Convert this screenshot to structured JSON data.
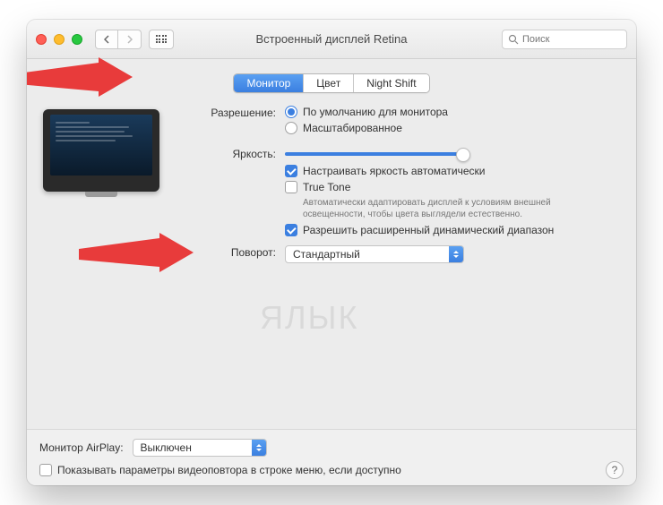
{
  "window": {
    "title": "Встроенный дисплей Retina"
  },
  "search": {
    "placeholder": "Поиск"
  },
  "tabs": {
    "monitor": "Монитор",
    "color": "Цвет",
    "nightshift": "Night Shift"
  },
  "labels": {
    "resolution": "Разрешение:",
    "brightness": "Яркость:",
    "rotation": "Поворот:",
    "airplay": "Монитор AirPlay:"
  },
  "options": {
    "resolution_default": "По умолчанию для монитора",
    "resolution_scaled": "Масштабированное",
    "auto_brightness": "Настраивать яркость автоматически",
    "true_tone": "True Tone",
    "true_tone_desc": "Автоматически адаптировать дисплей к условиям внешней освещенности, чтобы цвета выглядели естественно.",
    "edr": "Разрешить расширенный динамический диапазон",
    "rotation_value": "Стандартный",
    "airplay_value": "Выключен",
    "show_mirroring": "Показывать параметры видеоповтора в строке меню, если доступно"
  },
  "watermark": "ЯБЛЫК"
}
